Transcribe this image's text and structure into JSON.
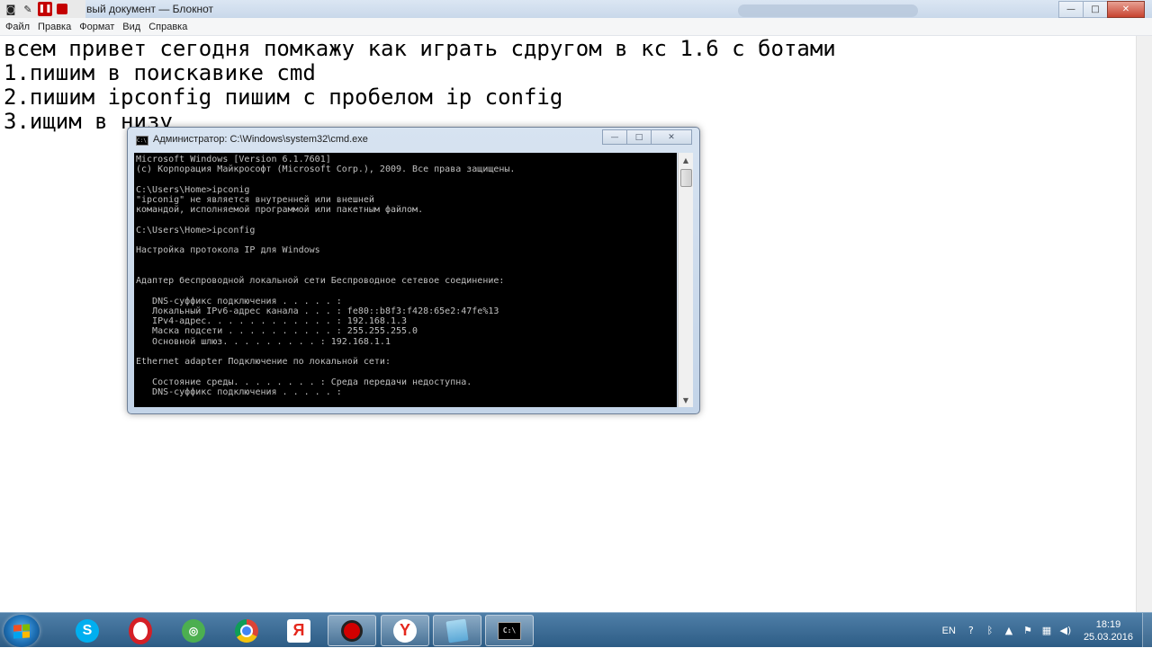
{
  "notepad": {
    "title": "Новый документ — Блокнот",
    "title_visible": "вый документ — Блокнот",
    "menu": [
      "Файл",
      "Правка",
      "Формат",
      "Вид",
      "Справка"
    ],
    "lines": [
      "всем привет сегодня помкажу как играть сдругом в кс 1.6 с ботами",
      "1.пишим в поискавике cmd",
      "2.пишим ipconfig пишим с пробелом ip config",
      "3.ищим в низу"
    ]
  },
  "recorder": {
    "icons": [
      "camera-icon",
      "pen-icon",
      "pause-icon",
      "stop-icon"
    ]
  },
  "window_controls": {
    "minimize": "—",
    "maximize": "□",
    "close": "✕"
  },
  "cmd": {
    "title": "Администратор: C:\\Windows\\system32\\cmd.exe",
    "icon_text": "C:\\",
    "output": [
      "Microsoft Windows [Version 6.1.7601]",
      "(c) Корпорация Майкрософт (Microsoft Corp.), 2009. Все права защищены.",
      "",
      "C:\\Users\\Home>ipconig",
      "\"ipconig\" не является внутренней или внешней",
      "командой, исполняемой программой или пакетным файлом.",
      "",
      "C:\\Users\\Home>ipconfig",
      "",
      "Настройка протокола IP для Windows",
      "",
      "",
      "Адаптер беспроводной локальной сети Беспроводное сетевое соединение:",
      "",
      "   DNS-суффикс подключения . . . . . :",
      "   Локальный IPv6-адрес канала . . . : fe80::b8f3:f428:65e2:47fe%13",
      "   IPv4-адрес. . . . . . . . . . . . : 192.168.1.3",
      "   Маска подсети . . . . . . . . . . : 255.255.255.0",
      "   Основной шлюз. . . . . . . . . : 192.168.1.1",
      "",
      "Ethernet adapter Подключение по локальной сети:",
      "",
      "   Состояние среды. . . . . . . . : Среда передачи недоступна.",
      "   DNS-суффикс подключения . . . . . :"
    ]
  },
  "taskbar": {
    "items": [
      {
        "name": "skype-icon",
        "label": "S"
      },
      {
        "name": "opera-icon",
        "label": ""
      },
      {
        "name": "maps-icon",
        "label": "◎"
      },
      {
        "name": "chrome-icon",
        "label": ""
      },
      {
        "name": "yandex-icon",
        "label": "Я"
      },
      {
        "name": "record-icon",
        "label": ""
      },
      {
        "name": "yandex-browser-icon",
        "label": "Y"
      },
      {
        "name": "notepad-icon",
        "label": ""
      },
      {
        "name": "cmd-icon",
        "label": "C:\\"
      }
    ],
    "tray": {
      "language": "EN",
      "time": "18:19",
      "date": "25.03.2016"
    }
  },
  "colors": {
    "taskbar": "#3a6a93",
    "console_bg": "#000000",
    "console_text": "#c0c0c0",
    "close_red": "#c7432f"
  }
}
